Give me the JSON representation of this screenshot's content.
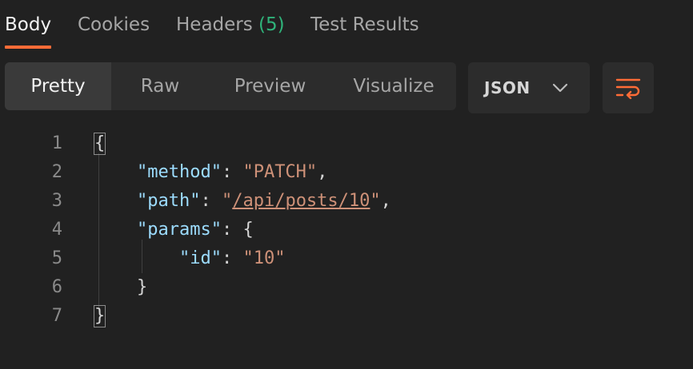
{
  "tabs": {
    "body": "Body",
    "cookies": "Cookies",
    "headers": "Headers",
    "headers_count": "(5)",
    "test_results": "Test Results"
  },
  "view_modes": {
    "pretty": "Pretty",
    "raw": "Raw",
    "preview": "Preview",
    "visualize": "Visualize"
  },
  "format_select": {
    "value": "JSON"
  },
  "line_numbers": [
    "1",
    "2",
    "3",
    "4",
    "5",
    "6",
    "7"
  ],
  "code": {
    "open_brace": "{",
    "method_key": "\"method\"",
    "method_value": "\"PATCH\"",
    "path_key": "\"path\"",
    "path_value": "/api/posts/10",
    "params_key": "\"params\"",
    "id_key": "\"id\"",
    "id_value": "\"10\"",
    "inner_close": "}",
    "close_brace": "}"
  },
  "colors": {
    "accent": "#ff6c37",
    "count_green": "#2fb37a",
    "json_key": "#9cdcfe",
    "json_string": "#ce9178"
  },
  "icons": [
    "chevron-down-icon",
    "wrap-lines-icon"
  ]
}
